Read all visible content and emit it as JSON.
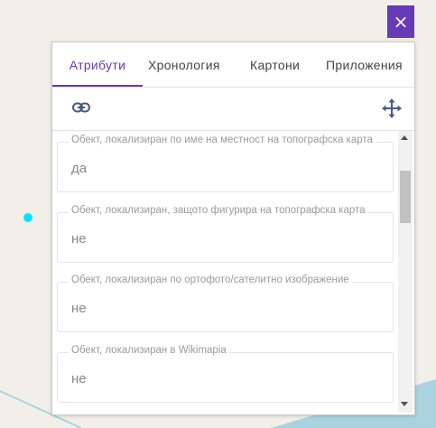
{
  "map": {
    "background": "#f2efe9",
    "water_color": "#aad3df",
    "marker_color": "#00e5ff"
  },
  "close_button": {
    "icon": "×",
    "color": "#673ab7"
  },
  "tabs": [
    {
      "label": "Атрибути",
      "active": true
    },
    {
      "label": "Хронология",
      "active": false
    },
    {
      "label": "Картони",
      "active": false
    },
    {
      "label": "Приложения",
      "active": false
    }
  ],
  "toolbar": {
    "link_icon": "link-icon",
    "move_icon": "move-icon"
  },
  "fields": [
    {
      "label": "Обект, локализиран по име на местност на топографска карта",
      "value": "да"
    },
    {
      "label": "Обект, локализиран, защото фигурира на топографска карта",
      "value": "не"
    },
    {
      "label": "Обект, локализиран по ортофото/сателитно изображение",
      "value": "не"
    },
    {
      "label": "Обект, локализиран в Wikimapia",
      "value": "не"
    }
  ]
}
